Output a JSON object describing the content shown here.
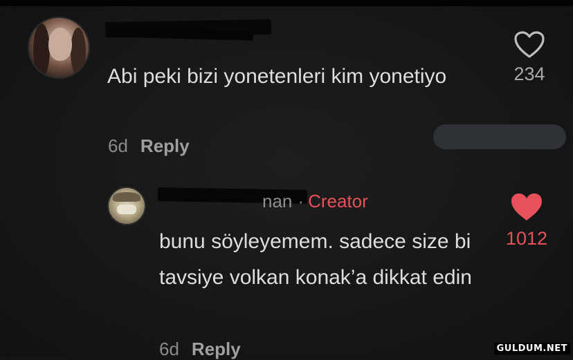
{
  "comment1": {
    "text": "Abi peki bizi yonetenleri kim yonetiyo",
    "age": "6d",
    "reply_label": "Reply",
    "likes": "234",
    "liked": false
  },
  "comment2": {
    "username_visible": "nan",
    "separator": "·",
    "badge": "Creator",
    "text": "bunu söyleyemem. sadece size bi tavsiye volkan konak’a dikkat edin",
    "age": "6d",
    "reply_label": "Reply",
    "likes": "1012",
    "liked": true
  },
  "colors": {
    "background": "#141414",
    "creator_accent": "#e8505b",
    "liked_heart": "#e8505b",
    "text_primary": "#dedede",
    "text_secondary": "#8b8b8b"
  },
  "icons": {
    "like_outline": "heart-outline-icon",
    "like_filled": "heart-filled-icon"
  },
  "watermark": "GULDUM.NET"
}
